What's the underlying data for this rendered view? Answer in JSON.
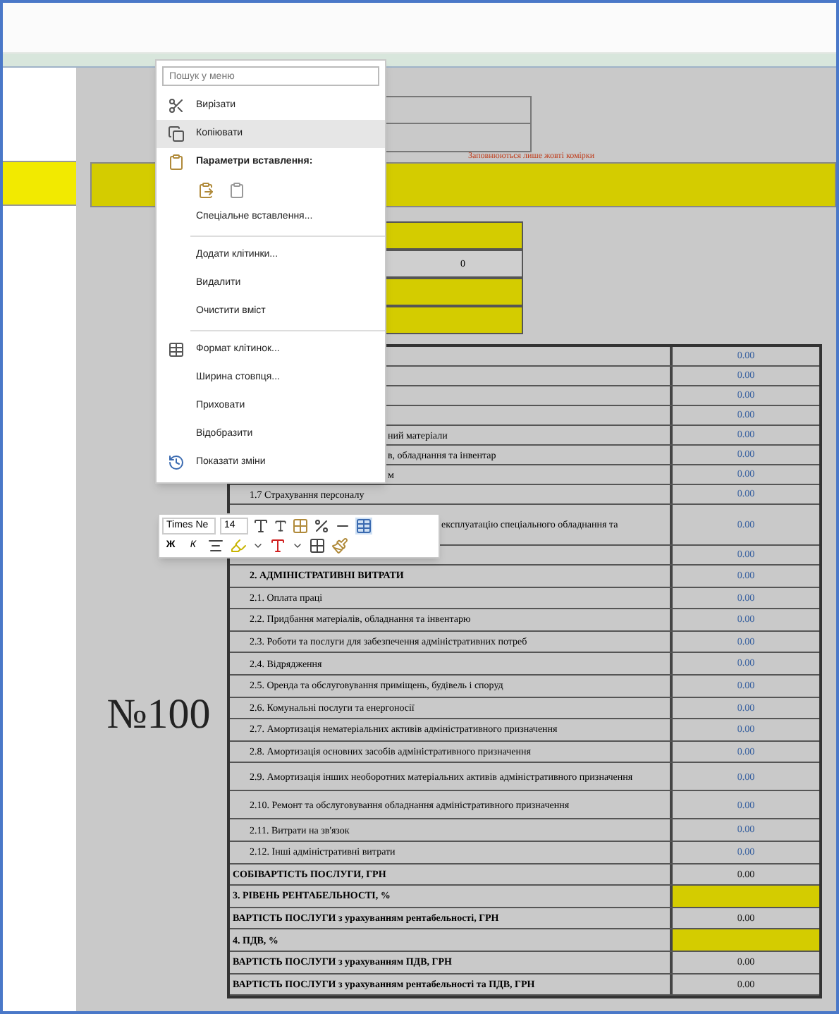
{
  "sheet": {
    "note": "Заповнюються лише жовті комірки",
    "number_title": "№100",
    "input_rows": [
      {
        "highlight": true
      },
      {
        "value": "0",
        "highlight": false
      },
      {
        "highlight": true
      },
      {
        "highlight": true
      }
    ],
    "rows": [
      {
        "kind": "covered",
        "value": "0.00",
        "highlight": false
      },
      {
        "kind": "covered",
        "value": "0.00",
        "highlight": false
      },
      {
        "kind": "covered",
        "value": "0.00",
        "highlight": false
      },
      {
        "kind": "covered",
        "value": "0.00",
        "highlight": false
      },
      {
        "kind": "covered",
        "label": "ний матеріали",
        "value": "0.00",
        "highlight": false
      },
      {
        "kind": "covered",
        "label": "в, обладнання та інвентар",
        "value": "0.00",
        "highlight": false
      },
      {
        "kind": "covered",
        "label": "м",
        "value": "0.00",
        "highlight": false
      },
      {
        "kind": "item",
        "label": "1.7 Страхування персоналу",
        "value": "0.00",
        "highlight": false
      },
      {
        "kind": "under-toolbar",
        "label": "експлуатацію спеціального обладнання та",
        "value": "0.00",
        "highlight": false
      },
      {
        "kind": "covered",
        "value": "0.00",
        "highlight": false
      },
      {
        "kind": "section",
        "label": "2. АДМІНІСТРАТИВНІ ВИТРАТИ",
        "value": "0.00",
        "highlight": false
      },
      {
        "kind": "item",
        "label": "2.1. Оплата праці",
        "value": "0.00",
        "highlight": false
      },
      {
        "kind": "item",
        "label": "2.2. Придбання матеріалів, обладнання та інвентарю",
        "value": "0.00",
        "highlight": false
      },
      {
        "kind": "item",
        "label": "2.3. Роботи та послуги для забезпечення адміністративних потреб",
        "value": "0.00",
        "highlight": false
      },
      {
        "kind": "item",
        "label": "2.4. Відрядження",
        "value": "0.00",
        "highlight": false
      },
      {
        "kind": "item",
        "label": "2.5. Оренда та обслуговування приміщень, будівель і споруд",
        "value": "0.00",
        "highlight": false
      },
      {
        "kind": "item",
        "label": "2.6. Комунальні послуги та енергоносії",
        "value": "0.00",
        "highlight": false
      },
      {
        "kind": "item",
        "label": "2.7. Амортизація нематеріальних активів адміністративного призначення",
        "value": "0.00",
        "highlight": false
      },
      {
        "kind": "item",
        "label": "2.8. Амортизація основних засобів адміністративного призначення",
        "value": "0.00",
        "highlight": false
      },
      {
        "kind": "item",
        "label": "2.9. Амортизація інших необоротних матеріальних активів адміністративного призначення",
        "value": "0.00",
        "highlight": false
      },
      {
        "kind": "item",
        "label": "2.10. Ремонт та обслуговування обладнання адміністративного призначення",
        "value": "0.00",
        "highlight": false
      },
      {
        "kind": "item",
        "label": "2.11. Витрати на зв'язок",
        "value": "0.00",
        "highlight": false
      },
      {
        "kind": "item",
        "label": "2.12. Інші адміністративні витрати",
        "value": "0.00",
        "highlight": false
      },
      {
        "kind": "total",
        "label": "СОБІВАРТІСТЬ ПОСЛУГИ, ГРН",
        "value": "0.00",
        "highlight": false
      },
      {
        "kind": "total",
        "label": "3. РІВЕНЬ РЕНТАБЕЛЬНОСТІ, %",
        "highlight": true
      },
      {
        "kind": "total",
        "label": "ВАРТІСТЬ ПОСЛУГИ з урахуванням рентабельності, ГРН",
        "value": "0.00",
        "highlight": false
      },
      {
        "kind": "total",
        "label": "4. ПДВ, %",
        "highlight": true
      },
      {
        "kind": "total",
        "label": "ВАРТІСТЬ ПОСЛУГИ з урахуванням ПДВ, ГРН",
        "value": "0.00",
        "highlight": false
      },
      {
        "kind": "total",
        "label": "ВАРТІСТЬ ПОСЛУГИ з урахуванням рентабельності та ПДВ, ГРН",
        "value": "0.00",
        "highlight": false
      }
    ]
  },
  "context_menu": {
    "search_placeholder": "Пошук у меню",
    "items": [
      {
        "kind": "item",
        "label": "Вирізати",
        "selected": false
      },
      {
        "kind": "item",
        "label": "Копіювати",
        "selected": true
      },
      {
        "kind": "heading",
        "label": "Параметри вставлення:",
        "selected": false
      },
      {
        "kind": "paste-options",
        "selected": false
      },
      {
        "kind": "item",
        "label": "Спеціальне вставлення...",
        "selected": false
      },
      {
        "kind": "separator"
      },
      {
        "kind": "item",
        "label": "Додати клітинки...",
        "selected": false
      },
      {
        "kind": "item",
        "label": "Видалити",
        "selected": false
      },
      {
        "kind": "item",
        "label": "Очистити вміст",
        "selected": false
      },
      {
        "kind": "separator"
      },
      {
        "kind": "item",
        "label": "Формат клітинок...",
        "selected": false
      },
      {
        "kind": "item",
        "label": "Ширина стовпця...",
        "selected": false
      },
      {
        "kind": "item",
        "label": "Приховати",
        "selected": false
      },
      {
        "kind": "item",
        "label": "Відобразити",
        "selected": false
      },
      {
        "kind": "item",
        "label": "Показати зміни",
        "selected": false
      }
    ]
  },
  "mini_toolbar": {
    "font": "Times Ne",
    "size": "14",
    "bold": "Ж",
    "italic": "К"
  }
}
